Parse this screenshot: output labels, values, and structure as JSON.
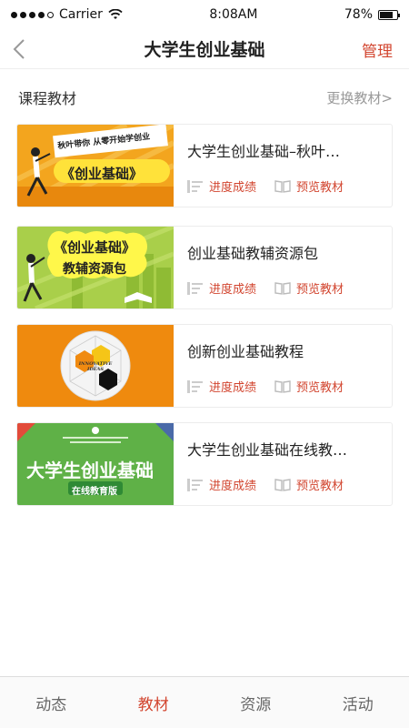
{
  "status_bar": {
    "carrier": "Carrier",
    "time": "8:08AM",
    "battery": "78%",
    "battery_level": 0.78
  },
  "nav": {
    "title": "大学生创业基础",
    "manage_label": "管理",
    "back_icon": "chevron-left-icon"
  },
  "section": {
    "title": "课程教材",
    "switch_label": "更换教材>"
  },
  "courses": [
    {
      "name": "大学生创业基础–秋叶…",
      "thumb_caption": "《创业基础》",
      "thumb_banner": "秋叶带你 从零开始学创业",
      "progress_label": "进度成绩",
      "preview_label": "预览教材"
    },
    {
      "name": "创业基础教辅资源包",
      "thumb_caption": "《创业基础》",
      "thumb_sub": "教辅资源包",
      "progress_label": "进度成绩",
      "preview_label": "预览教材"
    },
    {
      "name": "创新创业基础教程",
      "thumb_caption": "INNOVATIVE IDEAS",
      "progress_label": "进度成绩",
      "preview_label": "预览教材"
    },
    {
      "name": "大学生创业基础在线教…",
      "thumb_caption": "大学生创业基础",
      "thumb_sub": "在线教育版",
      "progress_label": "进度成绩",
      "preview_label": "预览教材"
    }
  ],
  "tabs": [
    {
      "label": "动态",
      "active": false
    },
    {
      "label": "教材",
      "active": true
    },
    {
      "label": "资源",
      "active": false
    },
    {
      "label": "活动",
      "active": false
    }
  ],
  "colors": {
    "accent": "#d2452f",
    "muted": "#999999"
  }
}
